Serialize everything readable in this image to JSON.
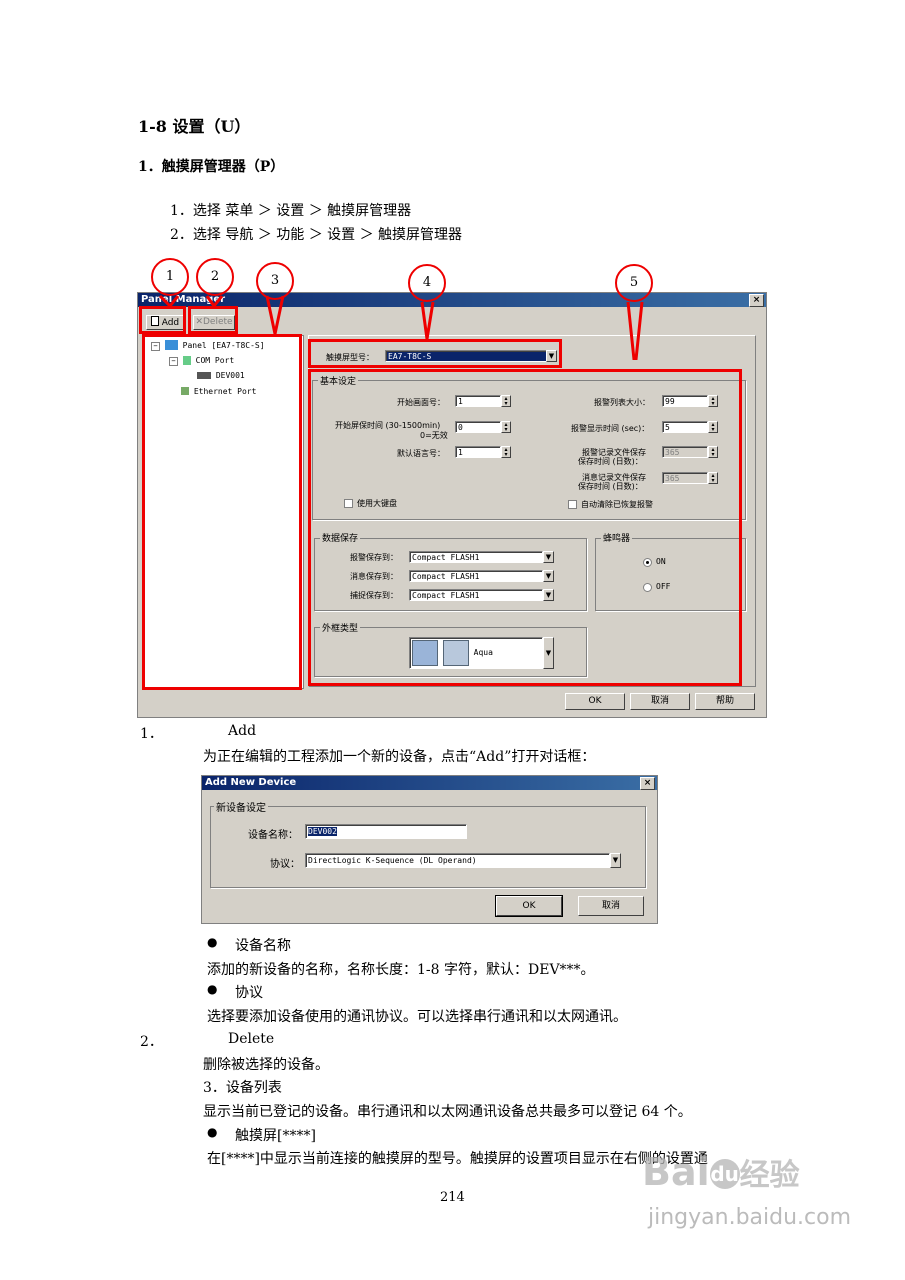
{
  "heading": "1-8 设置（U）",
  "subheading": "1．触摸屏管理器（P）",
  "menu_paths": [
    "1．选择 菜单 ＞ 设置 ＞ 触摸屏管理器",
    "2．选择 导航 ＞ 功能 ＞ 设置 ＞ 触摸屏管理器"
  ],
  "callouts": [
    "1",
    "2",
    "3",
    "4",
    "5"
  ],
  "panel": {
    "title": "Panel Manager",
    "close": "×",
    "add_btn": "Add",
    "delete_btn": "Delete",
    "tree": [
      "Panel [EA7-T8C-S]",
      "COM Port",
      "DEV001",
      "Ethernet Port"
    ],
    "model_label": "触摸屏型号：",
    "model_value": "EA7-T8C-S",
    "basic_group": "基本设定",
    "start_screen_label": "开始画面号：",
    "start_screen_value": "1",
    "saver_label_1": "开始屏保时间 (30-1500min)",
    "saver_label_2": "0=无效",
    "saver_value": "0",
    "lang_label": "默认语言号：",
    "lang_value": "1",
    "alarm_size_label": "报警列表大小：",
    "alarm_size_value": "99",
    "alarm_time_label": "报警显示时间 (sec)：",
    "alarm_time_value": "5",
    "alarm_keep_1": "报警记录文件保存",
    "alarm_keep_2": "保存时间 (日数)：",
    "alarm_keep_value": "365",
    "msg_keep_1": "消息记录文件保存",
    "msg_keep_2": "保存时间 (日数)：",
    "msg_keep_value": "365",
    "big_keyboard": "使用大键盘",
    "auto_clear": "自动清除已恢复报警",
    "save_group": "数据保存",
    "alarm_save_label": "报警保存到：",
    "msg_save_label": "消息保存到：",
    "capture_save_label": "捕捉保存到：",
    "save_value": "Compact FLASH1",
    "buzzer_group": "蜂鸣器",
    "on": "ON",
    "off": "OFF",
    "frame_group": "外框类型",
    "frame_value": "Aqua",
    "ok": "OK",
    "cancel": "取消",
    "help": "帮助"
  },
  "item1_num": "1．",
  "item1_title": "Add",
  "item1_desc": "为正在编辑的工程添加一个新的设备，点击“Add”打开对话框：",
  "dialog": {
    "title": "Add New Device",
    "close": "×",
    "group": "新设备设定",
    "name_label": "设备名称：",
    "name_value": "DEV002",
    "proto_label": "协议：",
    "proto_value": "DirectLogic K-Sequence (DL Operand)",
    "ok": "OK",
    "cancel": "取消"
  },
  "bullet": "●",
  "b1_title": "设备名称",
  "b1_desc": "添加的新设备的名称，名称长度：1-8 字符，默认：DEV***。",
  "b2_title": "协议",
  "b2_desc": "选择要添加设备使用的通讯协议。可以选择串行通讯和以太网通讯。",
  "item2_num": "2．",
  "item2_title": "Delete",
  "item2_desc": "删除被选择的设备。",
  "item3_title": "3．设备列表",
  "item3_desc": "显示当前已登记的设备。串行通讯和以太网通讯设备总共最多可以登记 64 个。",
  "b3_title": "触摸屏[****]",
  "b3_desc": "在[****]中显示当前连接的触摸屏的型号。触摸屏的设置项目显示在右侧的设置通",
  "page_number": "214",
  "watermark_1": "Bai",
  "watermark_2": "du",
  "watermark_3": "经验",
  "watermark_url": "jingyan.baidu.com"
}
